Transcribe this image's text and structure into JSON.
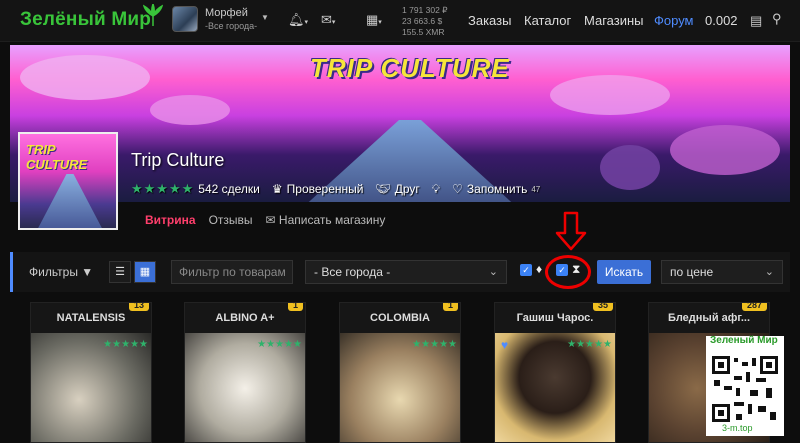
{
  "header": {
    "logo": "Зелёный Мир",
    "user_name": "Морфей",
    "user_city": "-Все города-",
    "balance_lines": [
      "1 791 302 ₽",
      "23 663.6 $",
      "155.5 XMR"
    ],
    "nav": [
      "Заказы",
      "Каталог",
      "Магазины",
      "Форум",
      "0.002"
    ]
  },
  "banner": {
    "title": "TRIP CULTURE"
  },
  "shop": {
    "logo_text": "TRIP CULTURE",
    "name": "Trip Culture",
    "stars": "★★★★★",
    "deals": "542 сделки",
    "verified": "Проверенный",
    "friend": "Друг",
    "remember": "Запомнить",
    "remember_count": "47"
  },
  "tabs": [
    "Витрина",
    "Отзывы",
    "Написать магазину"
  ],
  "filters": {
    "label": "Фильтры",
    "placeholder": "Фильтр по товарам",
    "city": "- Все города -",
    "search": "Искать",
    "sort": "по цене"
  },
  "products": [
    {
      "title": "NATALENSIS",
      "badge": "13"
    },
    {
      "title": "ALBINO A+",
      "badge": "1"
    },
    {
      "title": "COLOMBIA",
      "badge": "1"
    },
    {
      "title": "Гашиш Чарос.",
      "badge": "35"
    },
    {
      "title": "Бледный афг...",
      "badge": "287"
    }
  ],
  "product_stars": "★★★★★",
  "watermark": {
    "top": "Зеленый Мир",
    "bottom": "3-m.top"
  },
  "colors": {
    "accent": "#4f8cff",
    "brand": "#39c43a",
    "active_tab": "#ff3f6c",
    "badge": "#f0c020"
  }
}
